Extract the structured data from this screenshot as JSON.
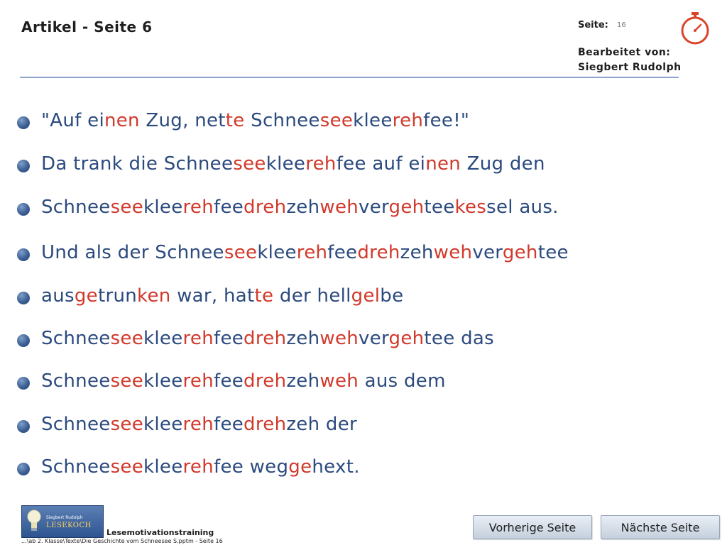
{
  "header": {
    "title": "Artikel - Seite 6",
    "seite_label": "Seite:",
    "seite_number": "16",
    "bearbeitet_label": "Bearbeitet von:",
    "author": "Siegbert Rudolph",
    "timer_icon": "stopwatch-icon"
  },
  "colors": {
    "text_blue": "#2b4a7e",
    "highlight_red": "#d1392b",
    "rule": "#8fa7c9"
  },
  "lines": [
    {
      "segments": [
        [
          "\"Auf ei",
          0
        ],
        [
          "nen",
          1
        ],
        [
          " Zug, net",
          0
        ],
        [
          "te",
          1
        ],
        [
          " Schnee",
          0
        ],
        [
          "see",
          1
        ],
        [
          "klee",
          0
        ],
        [
          "reh",
          1
        ],
        [
          "fee!\"",
          0
        ]
      ]
    },
    {
      "segments": [
        [
          "Da trank die Schnee",
          0
        ],
        [
          "see",
          1
        ],
        [
          "klee",
          0
        ],
        [
          "reh",
          1
        ],
        [
          "fee auf ei",
          0
        ],
        [
          "nen",
          1
        ],
        [
          " Zug den",
          0
        ]
      ]
    },
    {
      "segments": [
        [
          "Schnee",
          0
        ],
        [
          "see",
          1
        ],
        [
          "klee",
          0
        ],
        [
          "reh",
          1
        ],
        [
          "fee",
          0
        ],
        [
          "dreh",
          1
        ],
        [
          "zeh",
          0
        ],
        [
          "weh",
          1
        ],
        [
          "ver",
          0
        ],
        [
          "geh",
          1
        ],
        [
          "tee",
          0
        ],
        [
          "kes",
          1
        ],
        [
          "sel aus.",
          0
        ]
      ]
    },
    {
      "segments": [
        [
          "Und als der Schnee",
          0
        ],
        [
          "see",
          1
        ],
        [
          "klee",
          0
        ],
        [
          "reh",
          1
        ],
        [
          "fee",
          0
        ],
        [
          "dreh",
          1
        ],
        [
          "zeh",
          0
        ],
        [
          "weh",
          1
        ],
        [
          "ver",
          0
        ],
        [
          "geh",
          1
        ],
        [
          "tee",
          0
        ]
      ]
    },
    {
      "segments": [
        [
          "aus",
          0
        ],
        [
          "ge",
          1
        ],
        [
          "trun",
          0
        ],
        [
          "ken",
          1
        ],
        [
          " war, hat",
          0
        ],
        [
          "te",
          1
        ],
        [
          " der hell",
          0
        ],
        [
          "gel",
          1
        ],
        [
          "be",
          0
        ]
      ]
    },
    {
      "segments": [
        [
          "Schnee",
          0
        ],
        [
          "see",
          1
        ],
        [
          "klee",
          0
        ],
        [
          "reh",
          1
        ],
        [
          "fee",
          0
        ],
        [
          "dreh",
          1
        ],
        [
          "zeh",
          0
        ],
        [
          "weh",
          1
        ],
        [
          "ver",
          0
        ],
        [
          "geh",
          1
        ],
        [
          "tee das",
          0
        ]
      ]
    },
    {
      "segments": [
        [
          "Schnee",
          0
        ],
        [
          "see",
          1
        ],
        [
          "klee",
          0
        ],
        [
          "reh",
          1
        ],
        [
          "fee",
          0
        ],
        [
          "dreh",
          1
        ],
        [
          "zeh",
          0
        ],
        [
          "weh",
          1
        ],
        [
          " aus dem",
          0
        ]
      ]
    },
    {
      "segments": [
        [
          "Schnee",
          0
        ],
        [
          "see",
          1
        ],
        [
          "klee",
          0
        ],
        [
          "reh",
          1
        ],
        [
          "fee",
          0
        ],
        [
          "dreh",
          1
        ],
        [
          "zeh der",
          0
        ]
      ]
    },
    {
      "segments": [
        [
          "Schnee",
          0
        ],
        [
          "see",
          1
        ],
        [
          "klee",
          0
        ],
        [
          "reh",
          1
        ],
        [
          "fee weg",
          0
        ],
        [
          "ge",
          1
        ],
        [
          "hext.",
          0
        ]
      ]
    }
  ],
  "footer": {
    "logo_name": "Siegbert Rudolph",
    "logo_text": "LESEKOCH",
    "training_label": "Lesemotivationstraining",
    "file_path": "...\\ab 2. Klasse\\Texte\\Die Geschichte vom Schneesee S.pptm - Seite 16",
    "prev_button": "Vorherige Seite",
    "next_button": "Nächste Seite"
  }
}
